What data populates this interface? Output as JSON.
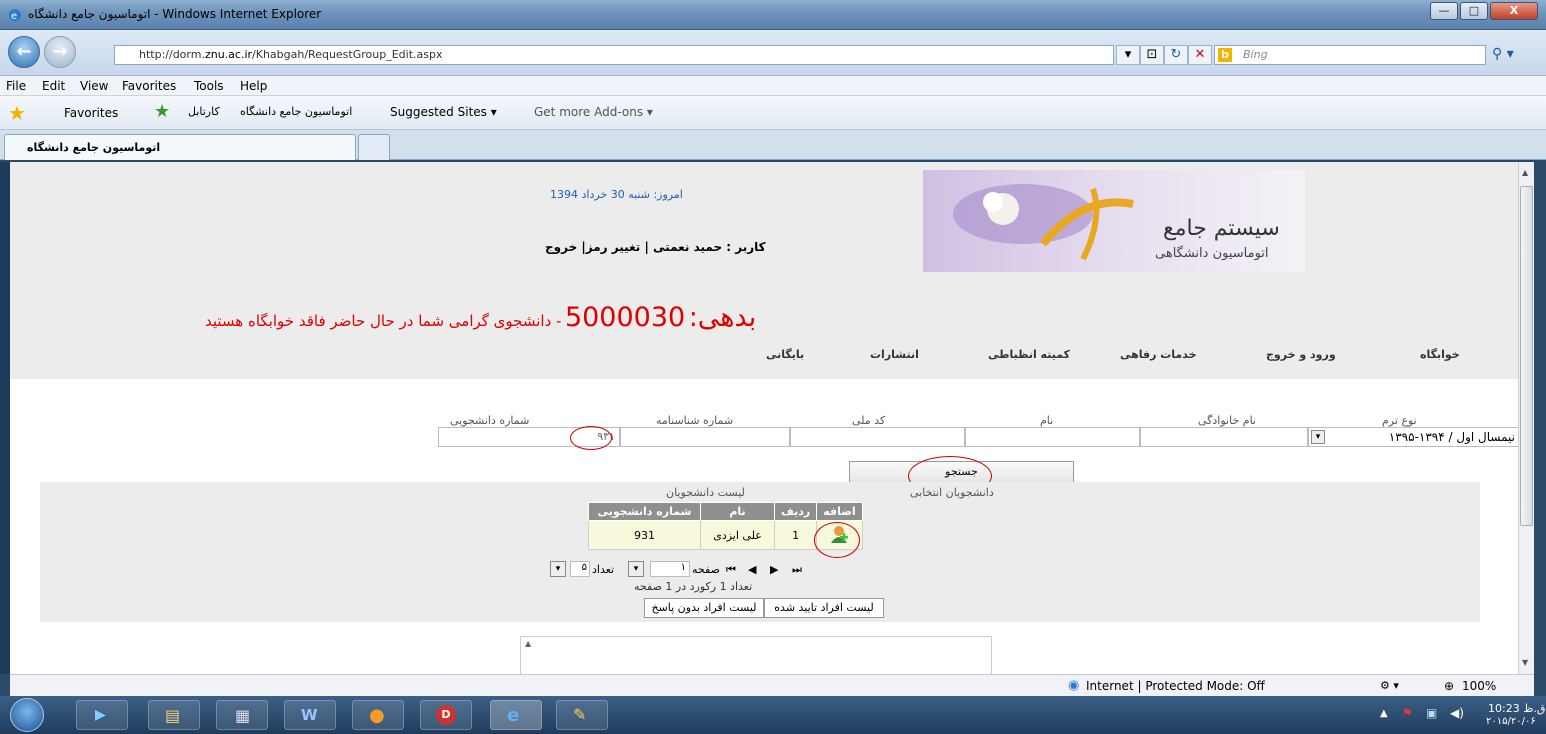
{
  "window": {
    "title": "اتوماسیون جامع دانشگاه - Windows Internet Explorer",
    "min": "—",
    "max": "□",
    "close": "X"
  },
  "address": {
    "url_prefix": "http://dorm.",
    "url_bold": "znu.ac.ir",
    "url_suffix": "/Khabgah/RequestGroup_Edit.aspx",
    "search_placeholder": "Bing"
  },
  "menu": [
    "File",
    "Edit",
    "View",
    "Favorites",
    "Tools",
    "Help"
  ],
  "favorites": {
    "label": "Favorites",
    "items": [
      "کارتابل",
      "اتوماسیون جامع دانشگاه",
      "Suggested Sites ▾",
      "Get more Add-ons ▾"
    ]
  },
  "tab": {
    "label": "اتوماسیون جامع دانشگاه"
  },
  "header": {
    "date": "امروز: شنبه 30 خرداد 1394",
    "user_line": "کاربر : حمید نعمتی | تغییر رمز| خروج",
    "logo_title": "سیستم جامع",
    "logo_sub": "اتوماسیون دانشگاهی",
    "debt_label": "بدهی:",
    "debt_value": "5000030",
    "debt_msg": "- دانشجوی گرامی شما در حال حاضر فاقد خوابگاه هستید"
  },
  "nav": [
    "خوابگاه",
    "ورود و خروج",
    "خدمات رفاهی",
    "کمیته انظباطی",
    "انتشارات",
    "بایگانی"
  ],
  "filters": {
    "term_label": "نوع ترم",
    "term_value": "نیمسال اول / ۱۳۹۴-۱۳۹۵",
    "family_label": "نام خانوادگی",
    "name_label": "نام",
    "national_label": "کد ملی",
    "birth_label": "شماره شناسنامه",
    "student_label": "شماره دانشجویی",
    "student_value": "۹۳۱"
  },
  "search_button": "جستجو",
  "lists": {
    "selected_title": "دانشجویان انتخابی",
    "students_title": "لیست دانشجویان"
  },
  "table": {
    "headers": [
      "اضافه",
      "ردیف",
      "نام",
      "شماره دانشجویی"
    ],
    "rows": [
      {
        "row": "1",
        "name": "علی ایزدی",
        "student_no": "931"
      }
    ]
  },
  "pager": {
    "page_label": "صفحه",
    "page_value": "۱",
    "count_label": "تعداد",
    "count_value": "۵",
    "summary": "تعداد 1 رکورد در 1 صفحه"
  },
  "buttons": {
    "approved": "لیست افراد تایید شده",
    "no_answer": "لیست افراد بدون پاسخ"
  },
  "status": {
    "zone": "Internet | Protected Mode: Off",
    "zoom": "100%"
  },
  "taskbar": {
    "time": "10:23 ق.ظ",
    "date": "۲۰۱۵/۲۰/۰۶"
  },
  "colors": {
    "debt": "#e00000",
    "link": "#1f5fb0",
    "grid_header": "#8f8f8f",
    "row_bg": "#f8f8dc"
  }
}
